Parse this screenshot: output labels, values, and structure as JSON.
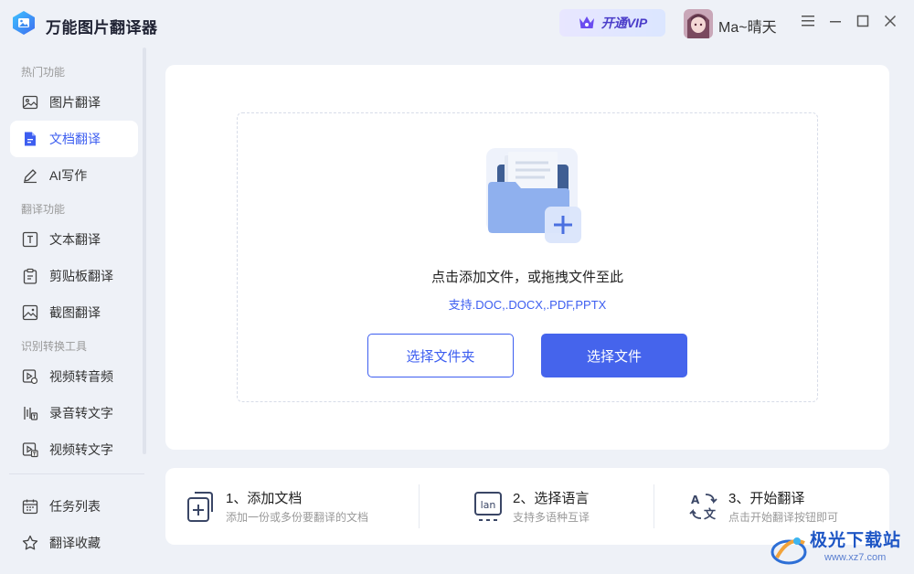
{
  "app": {
    "title": "万能图片翻译器"
  },
  "header": {
    "vip_label": "开通VIP",
    "username": "Ma~晴天"
  },
  "sidebar": {
    "sections": [
      {
        "label": "热门功能"
      },
      {
        "label": "翻译功能"
      },
      {
        "label": "识别转换工具"
      }
    ],
    "items": [
      {
        "label": "图片翻译",
        "icon": "image-icon"
      },
      {
        "label": "文档翻译",
        "icon": "document-icon",
        "active": true
      },
      {
        "label": "AI写作",
        "icon": "pen-icon"
      },
      {
        "label": "文本翻译",
        "icon": "text-icon"
      },
      {
        "label": "剪贴板翻译",
        "icon": "clipboard-icon"
      },
      {
        "label": "截图翻译",
        "icon": "screenshot-icon"
      },
      {
        "label": "视频转音频",
        "icon": "video-audio-icon"
      },
      {
        "label": "录音转文字",
        "icon": "recording-icon"
      },
      {
        "label": "视频转文字",
        "icon": "video-text-icon"
      }
    ],
    "bottom_items": [
      {
        "label": "任务列表",
        "icon": "calendar-icon"
      },
      {
        "label": "翻译收藏",
        "icon": "star-icon"
      }
    ]
  },
  "upload": {
    "hint": "点击添加文件，或拖拽文件至此",
    "formats": "支持.DOC,.DOCX,.PDF,PPTX",
    "select_folder_label": "选择文件夹",
    "select_file_label": "选择文件"
  },
  "steps": [
    {
      "title": "1、添加文档",
      "desc": "添加一份或多份要翻译的文档"
    },
    {
      "title": "2、选择语言",
      "desc": "支持多语种互译"
    },
    {
      "title": "3、开始翻译",
      "desc": "点击开始翻译按钮即可"
    }
  ],
  "step_icon_text": {
    "lan": "lan"
  },
  "watermark": {
    "title": "极光下载站",
    "url": "www.xz7.com"
  },
  "colors": {
    "accent": "#3d5ef0",
    "primary_button": "#4564ec",
    "background": "#eef1f7"
  }
}
